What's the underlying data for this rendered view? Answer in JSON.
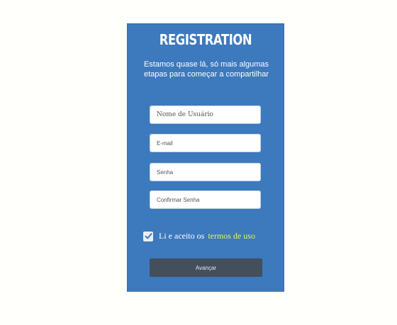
{
  "form": {
    "title": "REGISTRATION",
    "subtitle": "Estamos quase lá, só mais algumas etapas para começar a compartilhar",
    "fields": [
      {
        "label": "Nome de Usuário"
      },
      {
        "label": "E-mail"
      },
      {
        "label": "Senha"
      },
      {
        "label": "Confirmar Senha"
      }
    ],
    "terms": {
      "checked": true,
      "text": "Li e aceito os",
      "link": "termos de uso"
    },
    "submit_label": "Avançar"
  },
  "colors": {
    "background": "#fffffc",
    "card": "#3d79bd",
    "button": "#444f5c",
    "link": "#e3f26d"
  }
}
